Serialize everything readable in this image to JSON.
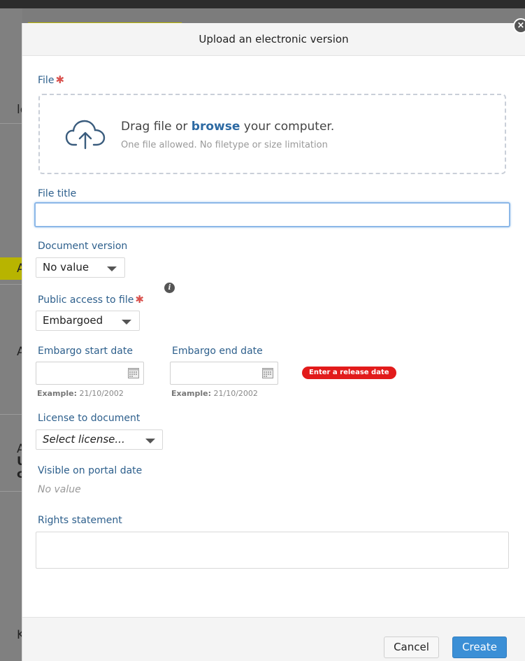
{
  "background": {
    "rows": [
      "lo",
      "Ac",
      "Ar",
      "Ad",
      "Up",
      "co",
      "Ke"
    ]
  },
  "modal": {
    "title": "Upload an electronic version",
    "close_glyph": "×",
    "file": {
      "label": "File",
      "required_mark": "✱",
      "drop_prefix": "Drag file or",
      "drop_link": "browse",
      "drop_suffix": "your computer.",
      "drop_hint": "One file allowed. No filetype or size limitation",
      "icon": "cloud-upload-icon"
    },
    "file_title": {
      "label": "File title",
      "value": ""
    },
    "document_version": {
      "label": "Document version",
      "selected": "No value"
    },
    "public_access": {
      "label": "Public access to file",
      "required_mark": "✱",
      "info_glyph": "i",
      "selected": "Embargoed"
    },
    "embargo_start": {
      "label": "Embargo start date",
      "value": "",
      "example_label": "Example:",
      "example_value": "21/10/2002"
    },
    "embargo_end": {
      "label": "Embargo end date",
      "value": "",
      "example_label": "Example:",
      "example_value": "21/10/2002",
      "error": "Enter a release date"
    },
    "license": {
      "label": "License to document",
      "selected": "Select license..."
    },
    "visible_on_portal": {
      "label": "Visible on portal date",
      "value": "No value"
    },
    "rights_statement": {
      "label": "Rights statement",
      "value": ""
    },
    "footer": {
      "cancel_label": "Cancel",
      "create_label": "Create"
    }
  },
  "colors": {
    "label_blue": "#2d5f8c",
    "link_blue": "#2d6aa3",
    "required_red": "#d9534f",
    "error_red": "#e21b1b",
    "primary_button": "#3b8fd6"
  }
}
